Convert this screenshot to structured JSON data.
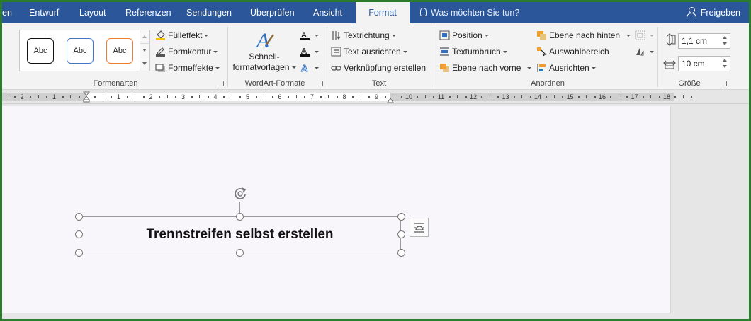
{
  "tabs": [
    {
      "label": "en",
      "active": false
    },
    {
      "label": "Entwurf",
      "active": false
    },
    {
      "label": "Layout",
      "active": false
    },
    {
      "label": "Referenzen",
      "active": false
    },
    {
      "label": "Sendungen",
      "active": false
    },
    {
      "label": "Überprüfen",
      "active": false
    },
    {
      "label": "Ansicht",
      "active": false
    },
    {
      "label": "Format",
      "active": true
    }
  ],
  "tell_me": "Was möchten Sie tun?",
  "share": "Freigeben",
  "groups": {
    "formenarten": {
      "label": "Formenarten",
      "samples": [
        "Abc",
        "Abc",
        "Abc"
      ],
      "sample_colors": [
        "#111111",
        "#4472c4",
        "#ed7d31"
      ],
      "fill": "Fülleffekt",
      "outline": "Formkontur",
      "effects": "Formeffekte"
    },
    "wordart": {
      "label": "WordArt-Formate",
      "quick_line1": "Schnell-",
      "quick_line2": "formatvorlagen"
    },
    "text": {
      "label": "Text",
      "direction": "Textrichtung",
      "align": "Text ausrichten",
      "link": "Verknüpfung erstellen"
    },
    "anordnen": {
      "label": "Anordnen",
      "position": "Position",
      "wrap": "Textumbruch",
      "forward": "Ebene nach vorne",
      "backward": "Ebene nach hinten",
      "selection": "Auswahlbereich",
      "align": "Ausrichten"
    },
    "groesse": {
      "label": "Größe",
      "height": "1,1 cm",
      "width": "10 cm"
    }
  },
  "ruler": {
    "labels": [
      "2",
      "1",
      "1",
      "2",
      "3",
      "4",
      "5",
      "6",
      "7",
      "8",
      "9",
      "10",
      "11",
      "12",
      "13",
      "14",
      "15",
      "16",
      "17",
      "18"
    ]
  },
  "document": {
    "textbox_text": "Trennstreifen selbst erstellen"
  },
  "colors": {
    "accent": "#2b579a",
    "frame": "#2b7d2b"
  }
}
